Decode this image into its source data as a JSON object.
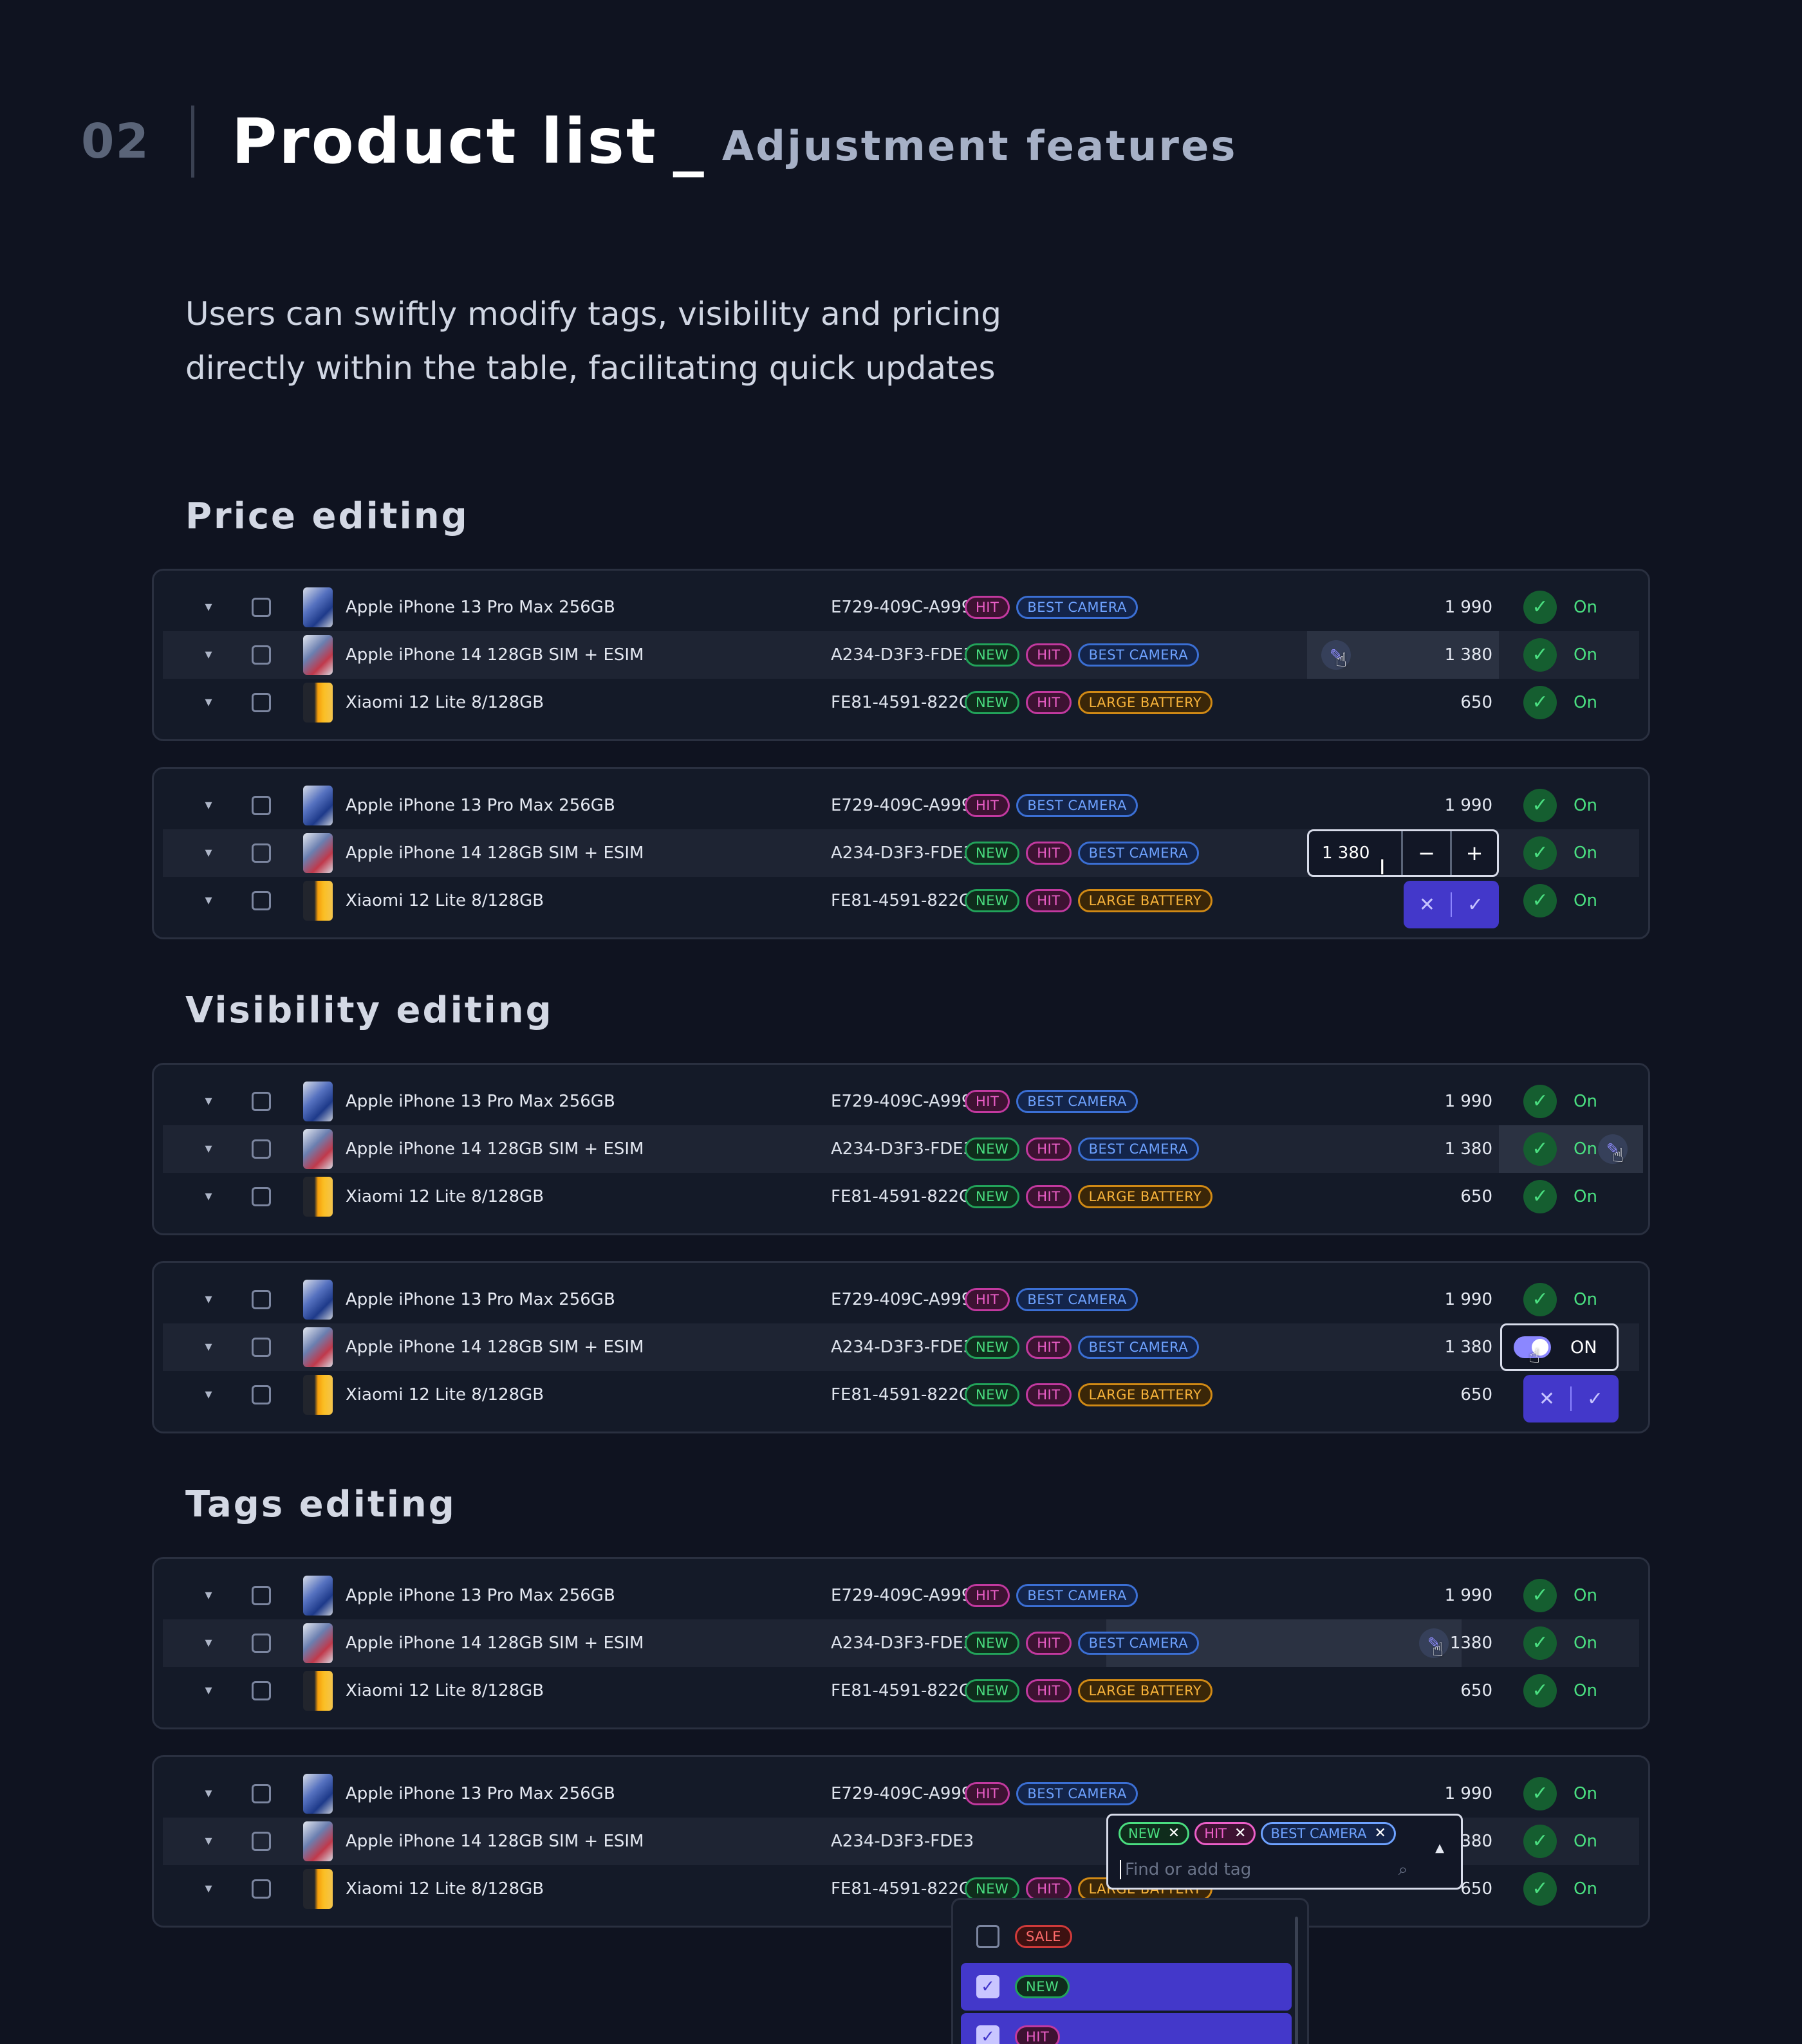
{
  "header": {
    "number": "02",
    "title": "Product list",
    "separator": "_",
    "subtitle": "Adjustment features"
  },
  "description": {
    "line1": "Users can swiftly modify tags, visibility and pricing",
    "line2": "directly within the table, facilitating quick updates"
  },
  "sections": {
    "price": "Price editing",
    "visibility": "Visibility editing",
    "tags": "Tags editing"
  },
  "rows": [
    {
      "name": "Apple iPhone 13 Pro Max 256GB",
      "sku": "E729-409C-A999",
      "tags": [
        "HIT",
        "BEST CAMERA"
      ],
      "price": "1 990",
      "status": "On"
    },
    {
      "name": "Apple iPhone 14 128GB SIM + ESIM",
      "sku": "A234-D3F3-FDE3",
      "tags": [
        "NEW",
        "HIT",
        "BEST CAMERA"
      ],
      "price": "1 380",
      "status": "On"
    },
    {
      "name": "Xiaomi 12 Lite 8/128GB",
      "sku": "FE81-4591-822C",
      "tags": [
        "NEW",
        "HIT",
        "LARGE BATTERY"
      ],
      "price": "650",
      "status": "On"
    }
  ],
  "tags_row_price": "1380",
  "price_editor": {
    "value": "1 380",
    "minus": "−",
    "plus": "+"
  },
  "confirm": {
    "cancel": "✕",
    "apply": "✓"
  },
  "toggle": {
    "label": "ON"
  },
  "tags_editor": {
    "chips": [
      "NEW",
      "HIT",
      "BEST CAMERA"
    ],
    "remove": "✕",
    "placeholder": "Find or add tag",
    "options": [
      {
        "label": "SALE",
        "checked": false
      },
      {
        "label": "NEW",
        "checked": true
      },
      {
        "label": "HIT",
        "checked": true
      }
    ]
  },
  "icons": {
    "expand": "chevron-down",
    "status": "check",
    "edit": "pencil",
    "search": "search",
    "collapse": "triangle-up"
  },
  "colors": {
    "background": "#0f1320",
    "accent": "#4338ca",
    "status_green": "#4ade80",
    "tag_hit": "#ec5fc8",
    "tag_new": "#4ade80",
    "tag_camera": "#6ea2ff",
    "tag_battery": "#f6b23a",
    "tag_sale": "#ff6b6b"
  }
}
